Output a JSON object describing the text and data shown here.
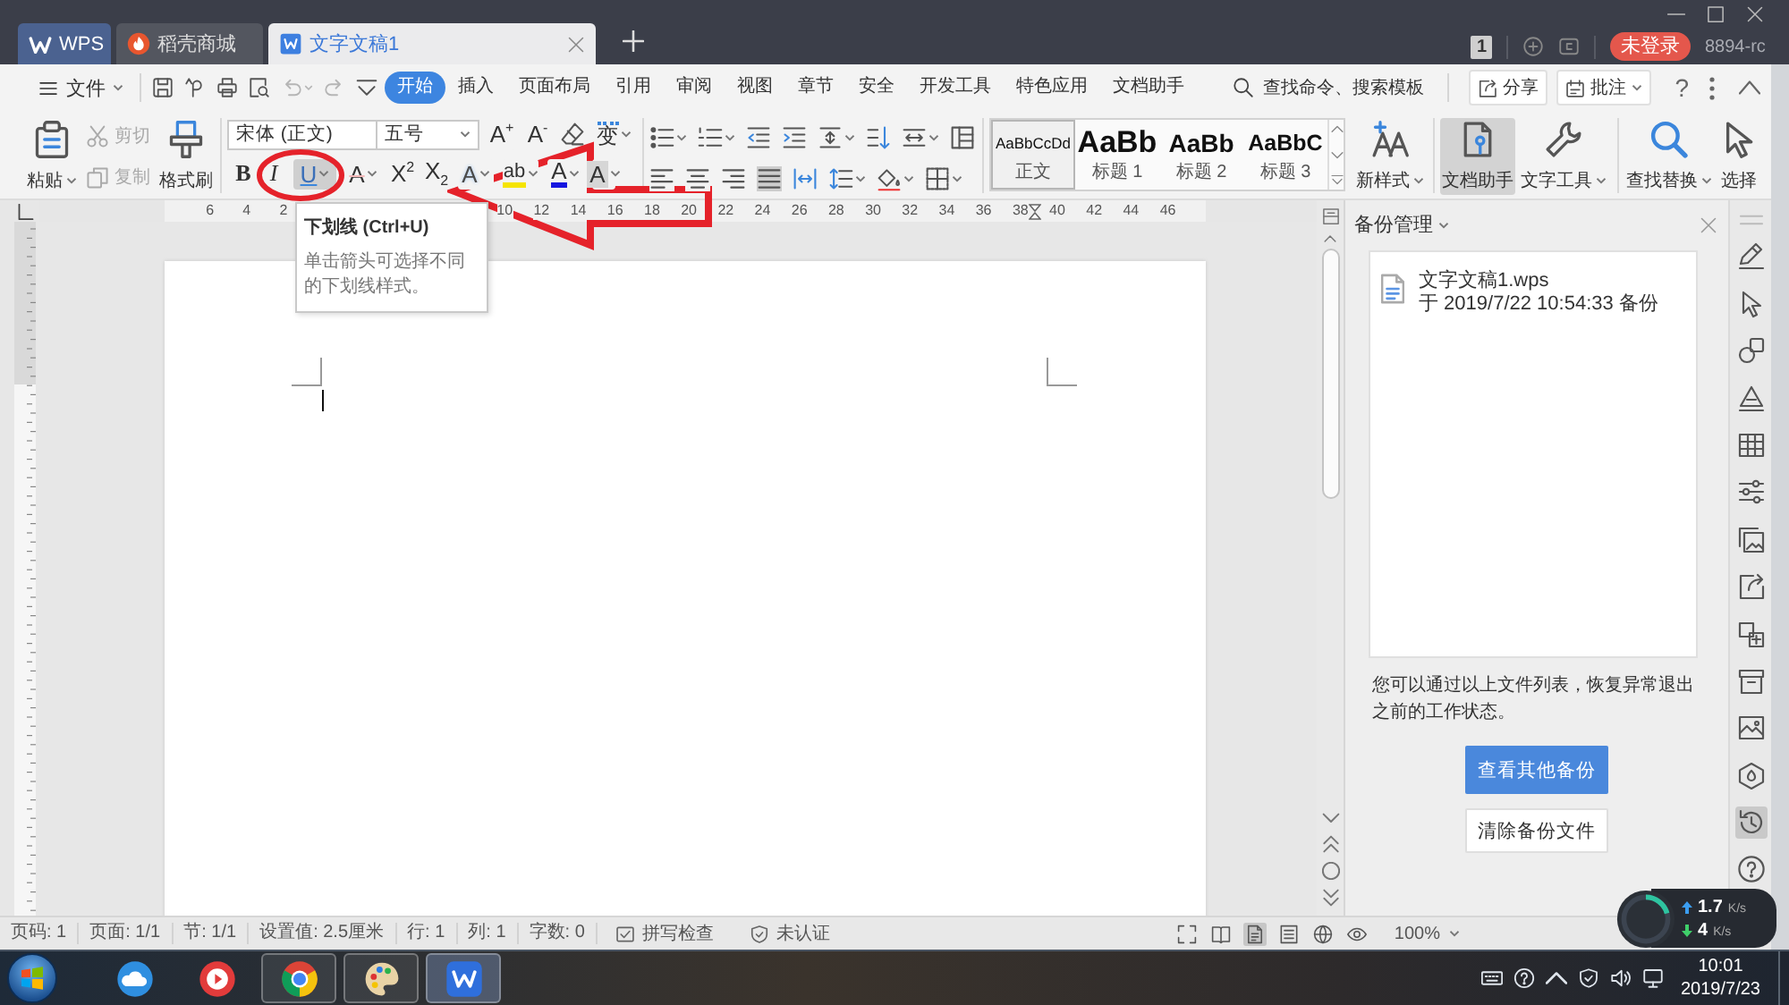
{
  "title_bar": {
    "tabs": [
      {
        "kind": "home",
        "label": "WPS",
        "selected": false
      },
      {
        "kind": "store",
        "label": "稻壳商城",
        "selected": false
      },
      {
        "kind": "document",
        "label": "文字文稿1",
        "selected": true
      }
    ],
    "window_count": "1",
    "login_button": "未登录",
    "user_name": "8894-rc"
  },
  "menu_bar": {
    "file_menu": "文件",
    "tabs": [
      {
        "label": "开始",
        "selected": true
      },
      {
        "label": "插入",
        "selected": false
      },
      {
        "label": "页面布局",
        "selected": false
      },
      {
        "label": "引用",
        "selected": false
      },
      {
        "label": "审阅",
        "selected": false
      },
      {
        "label": "视图",
        "selected": false
      },
      {
        "label": "章节",
        "selected": false
      },
      {
        "label": "安全",
        "selected": false
      },
      {
        "label": "开发工具",
        "selected": false
      },
      {
        "label": "特色应用",
        "selected": false
      },
      {
        "label": "文档助手",
        "selected": false
      }
    ],
    "search": {
      "placeholder": "查找命令、搜索模板"
    },
    "share_button": "分享",
    "comment_button": "批注",
    "help_button": "?"
  },
  "ribbon": {
    "clipboard": [
      {
        "kind": "paste",
        "label": "粘贴",
        "disabled": false
      },
      {
        "kind": "cut",
        "label": "剪切",
        "disabled": true
      },
      {
        "kind": "copy",
        "label": "复制",
        "disabled": true
      },
      {
        "kind": "format_painter",
        "label": "格式刷",
        "disabled": false
      }
    ],
    "font_name": "宋体 (正文)",
    "font_size": "五号",
    "font_tools": [
      {
        "kind": "grow",
        "glyph": "A$^{+}$"
      },
      {
        "kind": "shrink",
        "glyph": "A$^{-}$"
      },
      {
        "kind": "clear_format"
      },
      {
        "kind": "phonetic",
        "glyph": "变"
      }
    ],
    "format_buttons": [
      {
        "kind": "bold",
        "glyph": "B",
        "selected": false
      },
      {
        "kind": "italic",
        "glyph": "I",
        "selected": false
      },
      {
        "kind": "underline",
        "glyph": "U",
        "selected": true
      },
      {
        "kind": "strikethrough",
        "glyph": "A",
        "selected": false
      },
      {
        "kind": "superscript",
        "glyph": "X$^{2}$",
        "selected": false
      },
      {
        "kind": "subscript",
        "glyph": "X$_{2}$",
        "selected": false
      },
      {
        "kind": "effect",
        "glyph": "A",
        "selected": false
      },
      {
        "kind": "highlight",
        "glyph": "ab",
        "selected": false
      },
      {
        "kind": "font_color",
        "glyph": "A",
        "selected": false
      },
      {
        "kind": "shading",
        "glyph": "A",
        "selected": false
      }
    ],
    "paragraph_rows": [
      [
        {
          "kind": "bullets",
          "selected": false
        },
        {
          "kind": "numbering",
          "selected": false
        },
        {
          "kind": "outdent",
          "selected": false
        },
        {
          "kind": "indent",
          "selected": false
        },
        {
          "kind": "text_direction",
          "selected": false
        },
        {
          "kind": "sort",
          "selected": false
        },
        {
          "kind": "tab_spacing",
          "selected": false
        },
        {
          "kind": "columns",
          "selected": false
        }
      ],
      [
        {
          "kind": "align_left",
          "selected": false
        },
        {
          "kind": "align_center",
          "selected": false
        },
        {
          "kind": "align_right",
          "selected": false
        },
        {
          "kind": "justify",
          "selected": true
        },
        {
          "kind": "distribute",
          "selected": false
        },
        {
          "kind": "line_spacing",
          "selected": false
        },
        {
          "kind": "shading",
          "selected": false
        },
        {
          "kind": "borders",
          "selected": false
        }
      ]
    ],
    "styles": [
      {
        "kind": "body",
        "preview": "AaBbCcDd",
        "label": "正文",
        "selected": true
      },
      {
        "kind": "heading1",
        "preview": "AaBb",
        "label": "标题 1",
        "selected": false
      },
      {
        "kind": "heading2",
        "preview": "AaBb",
        "label": "标题 2",
        "selected": false
      },
      {
        "kind": "heading3",
        "preview": "AaBbC",
        "label": "标题 3",
        "selected": false
      }
    ],
    "new_style": "新样式",
    "tools": [
      {
        "kind": "assistant",
        "label": "文档助手",
        "selected": true
      },
      {
        "kind": "text_tools",
        "label": "文字工具",
        "selected": false
      },
      {
        "kind": "find_replace",
        "label": "查找替换",
        "selected": false
      },
      {
        "kind": "select",
        "label": "选择",
        "selected": false
      }
    ]
  },
  "ruler": {
    "left_numbers": [
      "6",
      "4",
      "2"
    ],
    "right_numbers": [
      "10",
      "12",
      "14",
      "16",
      "18",
      "20",
      "22",
      "24",
      "26",
      "28",
      "30",
      "32",
      "34",
      "36",
      "38",
      "40",
      "42",
      "44",
      "46"
    ]
  },
  "tooltip": {
    "title": "下划线 (Ctrl+U)",
    "text": "单击箭头可选择不同的下划线样式。"
  },
  "backup_panel": {
    "title": "备份管理",
    "files": [
      {
        "name": "文字文稿1.wps",
        "time": "于 2019/7/22 10:54:33 备份"
      }
    ],
    "note": "您可以通过以上文件列表，恢复异常退出之前的工作状态。",
    "primary_button": "查看其他备份",
    "secondary_button": "清除备份文件"
  },
  "side_tools": [
    {
      "kind": "pen",
      "selected": false
    },
    {
      "kind": "pointer",
      "selected": false
    },
    {
      "kind": "shapes",
      "selected": false
    },
    {
      "kind": "triangle",
      "selected": false
    },
    {
      "kind": "table",
      "selected": false
    },
    {
      "kind": "sliders",
      "selected": false
    },
    {
      "kind": "gallery",
      "selected": false
    },
    {
      "kind": "share",
      "selected": false
    },
    {
      "kind": "translate",
      "selected": false
    },
    {
      "kind": "archive",
      "selected": false
    },
    {
      "kind": "image",
      "selected": false
    },
    {
      "kind": "hexagon",
      "selected": false
    },
    {
      "kind": "history",
      "selected": true
    },
    {
      "kind": "help",
      "selected": false
    }
  ],
  "status_bar": {
    "fields": [
      "页码: 1",
      "页面: 1/1",
      "节: 1/1",
      "设置值: 2.5厘米",
      "行: 1",
      "列: 1",
      "字数: 0"
    ],
    "spell_check": "拼写检查",
    "certification": "未认证",
    "views": [
      {
        "kind": "fullscreen",
        "selected": false
      },
      {
        "kind": "reading",
        "selected": false
      },
      {
        "kind": "page",
        "selected": true
      },
      {
        "kind": "outline",
        "selected": false
      },
      {
        "kind": "web",
        "selected": false
      },
      {
        "kind": "eye",
        "selected": false
      }
    ],
    "zoom": "100%"
  },
  "net_speed": {
    "upload": {
      "value": "1.7",
      "unit": "K/s"
    },
    "download": {
      "value": "4",
      "unit": "K/s"
    }
  },
  "taskbar": {
    "apps": [
      {
        "kind": "cloud",
        "running": false,
        "selected": false
      },
      {
        "kind": "media",
        "running": false,
        "selected": false
      },
      {
        "kind": "browser",
        "running": true,
        "selected": false
      },
      {
        "kind": "paint",
        "running": true,
        "selected": false
      },
      {
        "kind": "writer",
        "running": true,
        "selected": true
      }
    ],
    "clock": {
      "time": "10:01",
      "date": "2019/7/23"
    }
  }
}
